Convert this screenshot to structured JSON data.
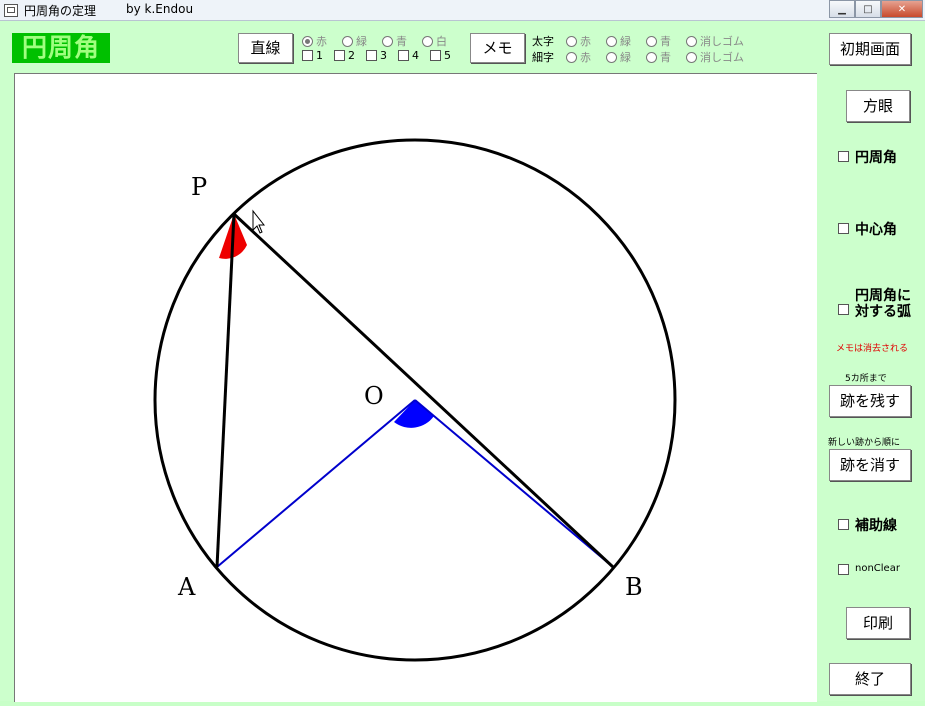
{
  "window": {
    "title": "円周角の定理",
    "author": "by k.Endou"
  },
  "app": {
    "logo": "円周角"
  },
  "toolbar": {
    "line_button": "直線",
    "line_colors": [
      "赤",
      "緑",
      "青",
      "白"
    ],
    "line_slots": [
      "1",
      "2",
      "3",
      "4",
      "5"
    ],
    "memo_button": "メモ",
    "thick_label": "太字",
    "thin_label": "細字",
    "pen_options": [
      "赤",
      "緑",
      "青",
      "消しゴム"
    ],
    "reset_button": "初期画面"
  },
  "sidebar": {
    "grid_button": "方眼",
    "inscribed_angle": "円周角",
    "central_angle": "中心角",
    "arc_label": "円周角に対する弧",
    "memo_note": "メモは消去される",
    "keep_note": "5カ所まで",
    "keep_button": "跡を残す",
    "erase_note": "新しい跡から順に",
    "erase_button": "跡を消す",
    "aux_line": "補助線",
    "nonclear": "nonClear",
    "print_button": "印刷",
    "exit_button": "終了"
  },
  "figure": {
    "point_p": "P",
    "point_o": "O",
    "point_a": "A",
    "point_b": "B"
  },
  "colors": {
    "background": "#ccffcc",
    "logo_bg": "#00c000",
    "inscribed_angle": "#ee0000",
    "central_angle": "#0000ff",
    "radii": "#0000cc",
    "note": "#e00000"
  }
}
